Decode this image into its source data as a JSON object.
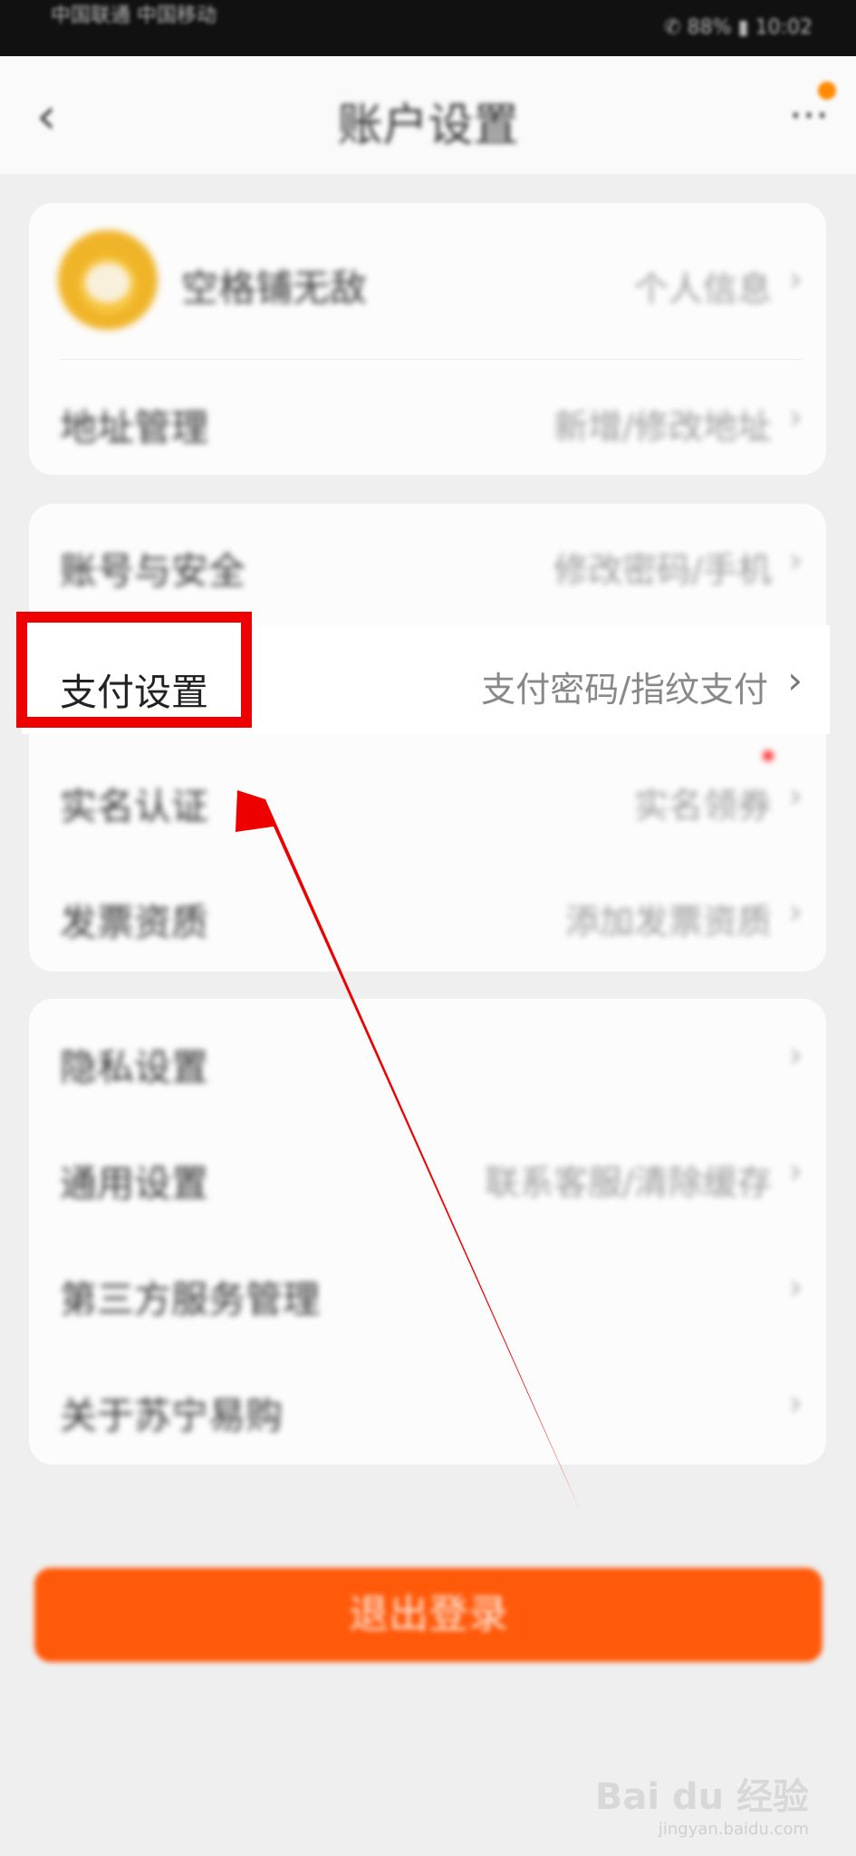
{
  "status_bar": {
    "carrier": "中国联通 中国移动",
    "right": "✆ 88% ▮ 10:02"
  },
  "nav": {
    "back_icon": "chevron-left-icon",
    "title": "账户设置",
    "more_icon": "more-dots-icon"
  },
  "sections": [
    [
      {
        "label": "空格铺无敌",
        "hint": "个人信息"
      },
      {
        "label": "地址管理",
        "hint": "新增/修改地址"
      }
    ],
    [
      {
        "label": "账号与安全",
        "hint": "修改密码/手机"
      },
      {
        "label": "支付设置",
        "hint": "支付密码/指纹支付"
      },
      {
        "label": "实名认证",
        "hint": "实名领券"
      },
      {
        "label": "发票资质",
        "hint": "添加发票资质"
      }
    ],
    [
      {
        "label": "隐私设置",
        "hint": ""
      },
      {
        "label": "通用设置",
        "hint": "联系客服/清除缓存"
      },
      {
        "label": "第三方服务管理",
        "hint": ""
      },
      {
        "label": "关于苏宁易购",
        "hint": ""
      }
    ]
  ],
  "chevron": "›",
  "logout_button": "退出登录",
  "watermark": {
    "brand": "Bai du 经验",
    "url": "jingyan.baidu.com"
  },
  "colors": {
    "accent": "#ff5a0a",
    "highlight_box": "#ee0000",
    "badge": "#ff8a00"
  }
}
